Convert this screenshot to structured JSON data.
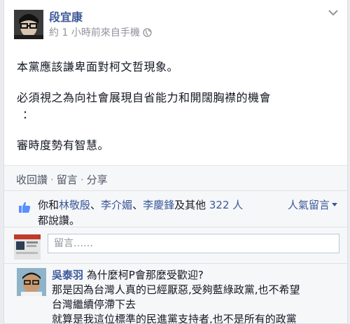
{
  "post": {
    "author": "段宜康",
    "meta_prefix": "約 ",
    "meta_time_num": "1",
    "meta_suffix": " 小時前來自手機",
    "lines": [
      "本黨應該謙卑面對柯文哲現象。",
      "必須視之為向社會展現自省能力和開闊胸襟的機會",
      "：",
      "審時度勢有智慧。"
    ]
  },
  "actions": {
    "retract_like": "收回讚",
    "comment": "留言",
    "share": "分享",
    "separator": "·"
  },
  "likes": {
    "prefix": "你和",
    "person1": "林敬殷",
    "sep1": "、",
    "person2": "李介媚",
    "sep2": "、",
    "person3": "李慶鋒",
    "and_others": "及其他 ",
    "count": "322",
    "count_suffix": " 人",
    "line2": "都說讚。",
    "popular": "人氣留言"
  },
  "compose": {
    "placeholder": "留言……"
  },
  "comment": {
    "author": "吳泰羽",
    "line1_rest": "為什麼柯P會那麼受歡迎?",
    "line2": "那是因為台灣人真的已經厭惡,受夠藍綠政黨,也不希望",
    "line3": "台灣繼續停滯下去",
    "line4": "就算是我這位標準的民進黨支持者,也不是所有的政黨"
  },
  "colors": {
    "link": "#3b5998",
    "muted": "#90949c",
    "panel": "#f6f7f9"
  }
}
